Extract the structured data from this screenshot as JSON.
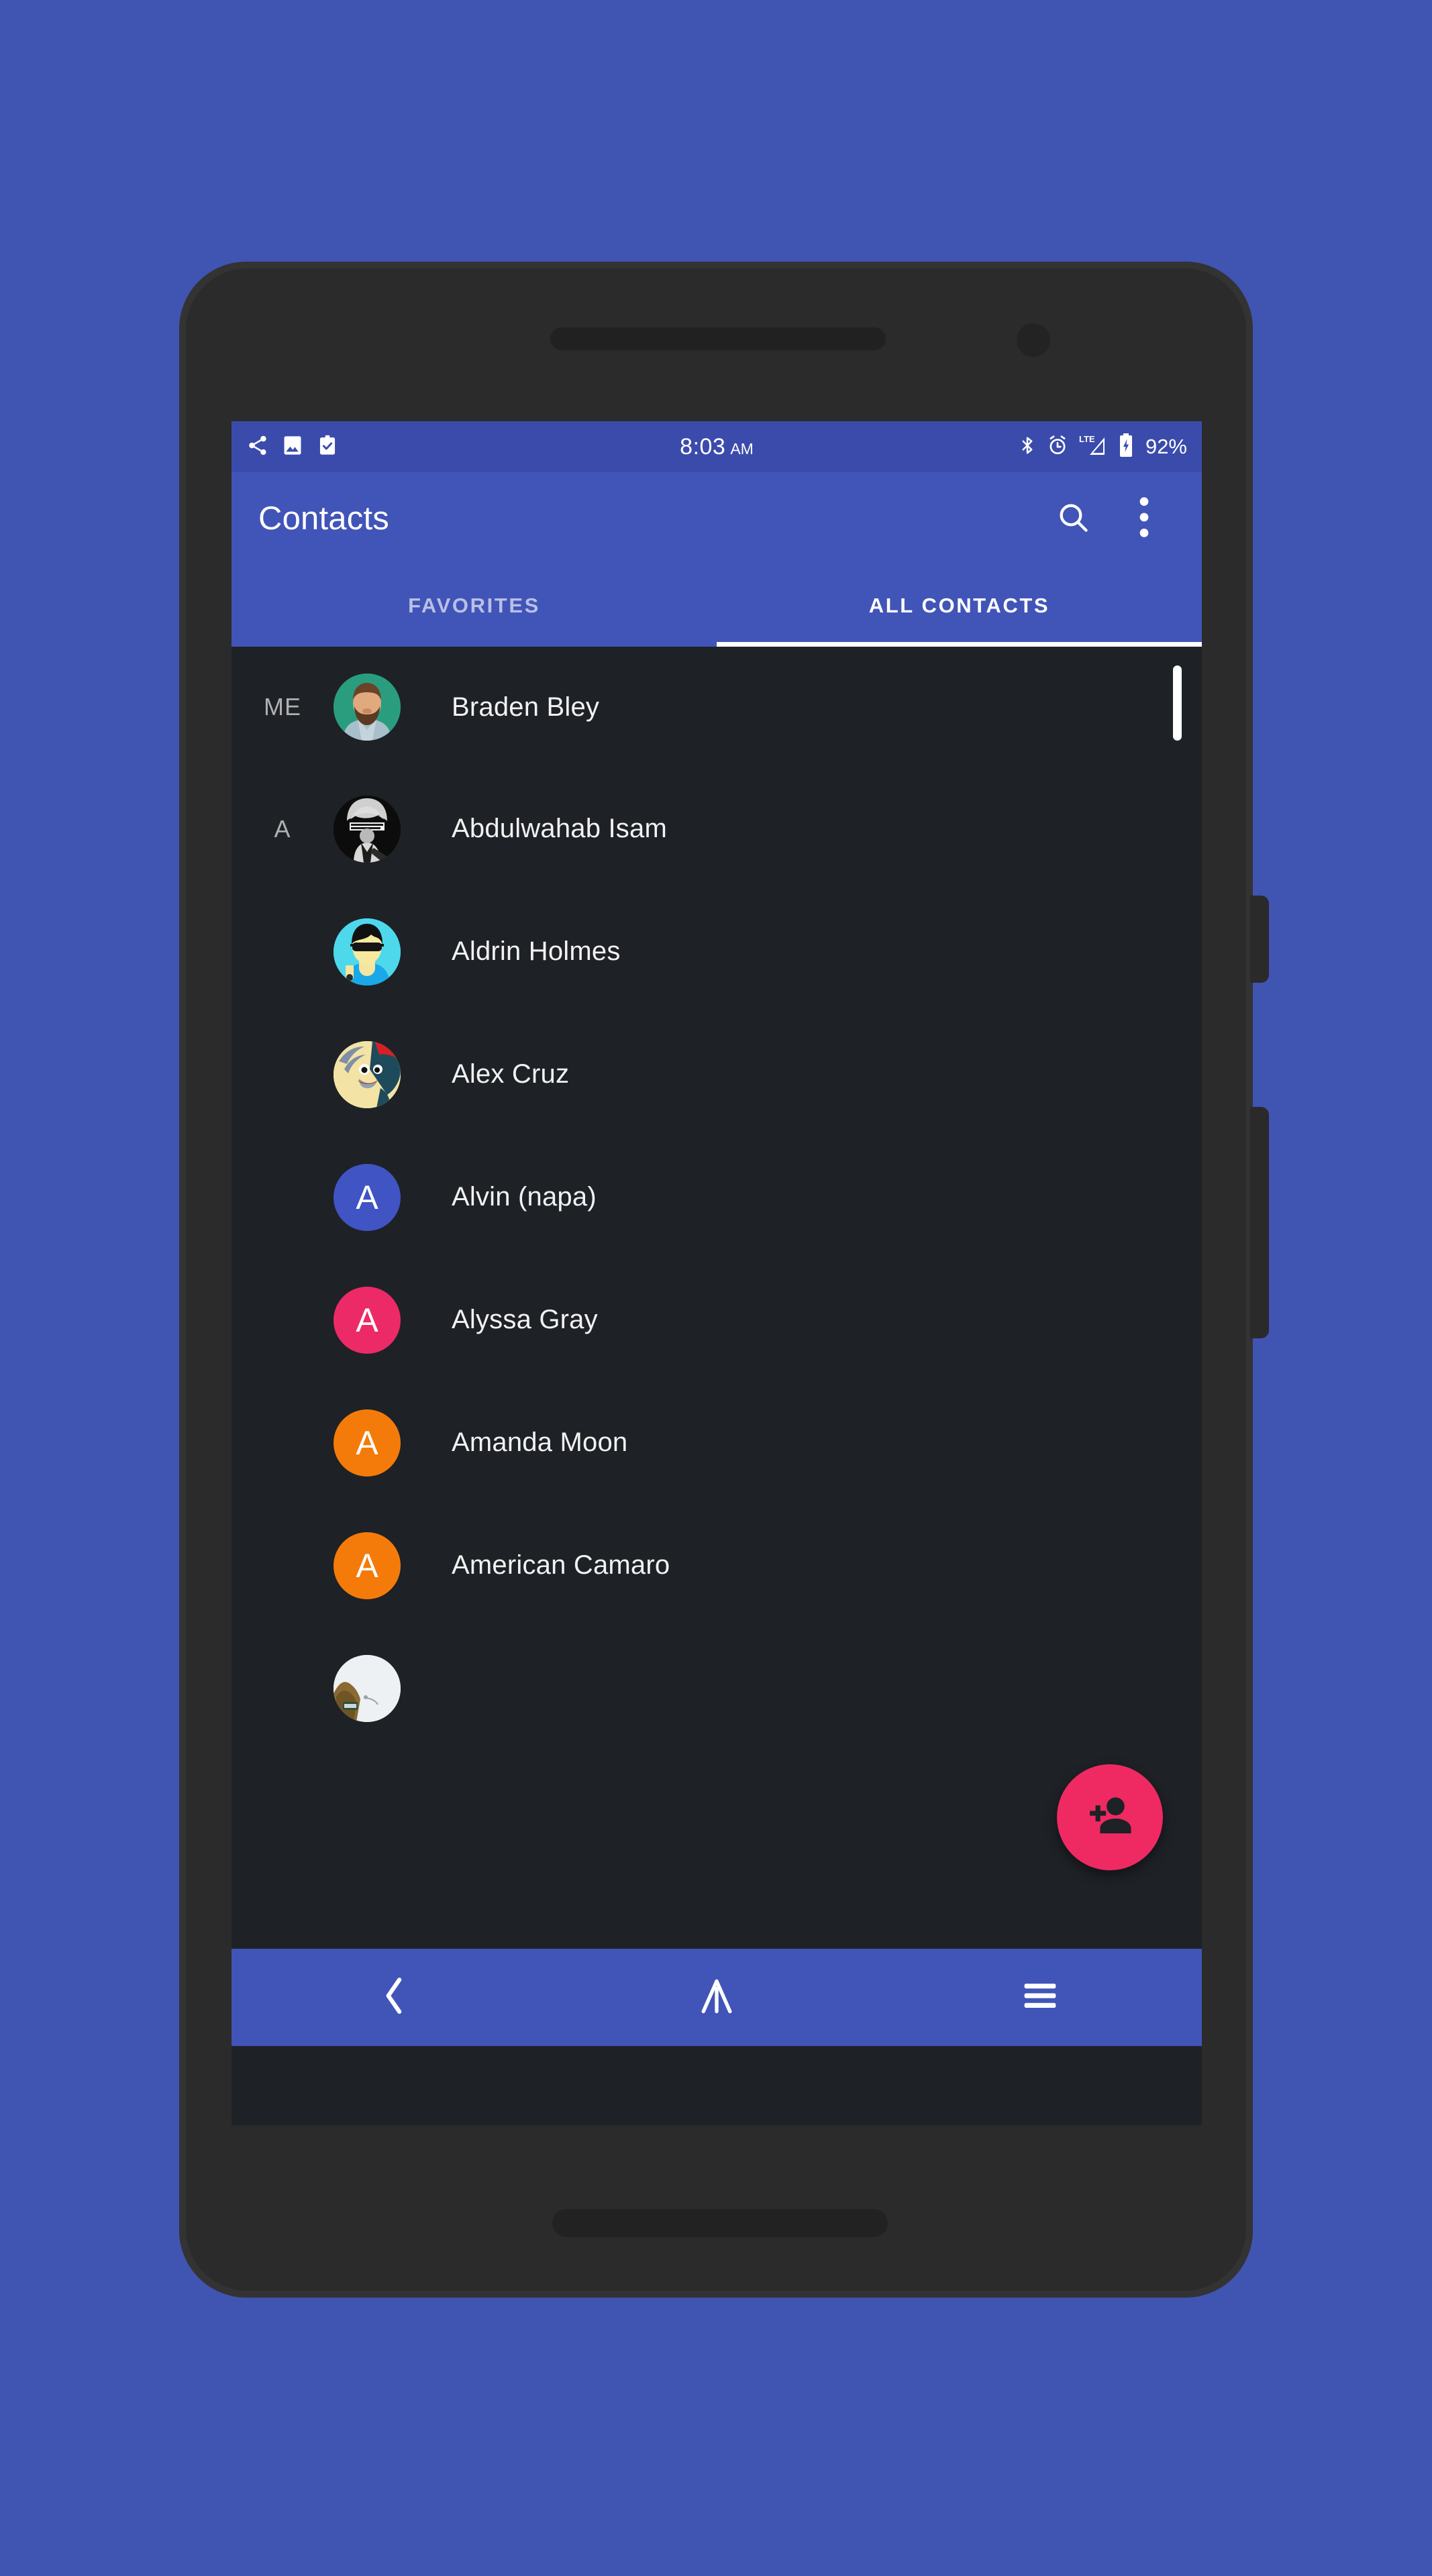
{
  "theme": {
    "background": "#4054b2",
    "app_bar": "#4154b8",
    "status_bar": "#3b4bac",
    "list_background": "#1e2126",
    "accent_fab": "#ef2a62",
    "active_tab_text": "#ffffff",
    "inactive_tab_text": "#b9c0e6"
  },
  "status_bar": {
    "icons_left": [
      "share-icon",
      "image-icon",
      "clipboard-check-icon"
    ],
    "time": "8:03",
    "am_pm": "AM",
    "icons_right": [
      "bluetooth-icon",
      "alarm-icon",
      "lte-signal-icon",
      "battery-charging-icon"
    ],
    "network": "LTE",
    "battery_percent": "92%"
  },
  "app_bar": {
    "title": "Contacts",
    "search_label": "search-icon",
    "overflow_label": "more-options-icon"
  },
  "tabs": [
    {
      "label": "FAVORITES",
      "active": false
    },
    {
      "label": "ALL CONTACTS",
      "active": true
    }
  ],
  "contacts": [
    {
      "section": "ME",
      "name": "Braden Bley",
      "avatar_type": "photo",
      "avatar_art": "bearded-man",
      "avatar_color": "#2a9d7f"
    },
    {
      "section": "A",
      "name": "Abdulwahab Isam",
      "avatar_type": "photo",
      "avatar_art": "bw-portrait",
      "avatar_color": "#0a0a0a"
    },
    {
      "section": "",
      "name": "Aldrin Holmes",
      "avatar_type": "photo",
      "avatar_art": "sunglasses-man",
      "avatar_color": "#4dd8ec"
    },
    {
      "section": "",
      "name": "Alex Cruz",
      "avatar_type": "photo",
      "avatar_art": "penguin-santa",
      "avatar_color": "#f7e6a8"
    },
    {
      "section": "",
      "name": "Alvin (napa)",
      "avatar_type": "initial",
      "initial": "A",
      "avatar_color": "#4054c4"
    },
    {
      "section": "",
      "name": "Alyssa Gray",
      "avatar_type": "initial",
      "initial": "A",
      "avatar_color": "#ed2a68"
    },
    {
      "section": "",
      "name": "Amanda Moon",
      "avatar_type": "initial",
      "initial": "A",
      "avatar_color": "#f47b0a"
    },
    {
      "section": "",
      "name": "American Camaro",
      "avatar_type": "initial",
      "initial": "A",
      "avatar_color": "#f47b0a"
    },
    {
      "section": "",
      "name": "",
      "avatar_type": "photo",
      "avatar_art": "landscape",
      "avatar_color": "#e9ecef"
    }
  ],
  "fab": {
    "label": "add-contact-icon"
  },
  "nav_bar": {
    "back": "back-icon",
    "home": "home-icon",
    "recents": "recents-icon"
  },
  "scrollbar": {
    "label": "list-scrollbar-thumb"
  }
}
